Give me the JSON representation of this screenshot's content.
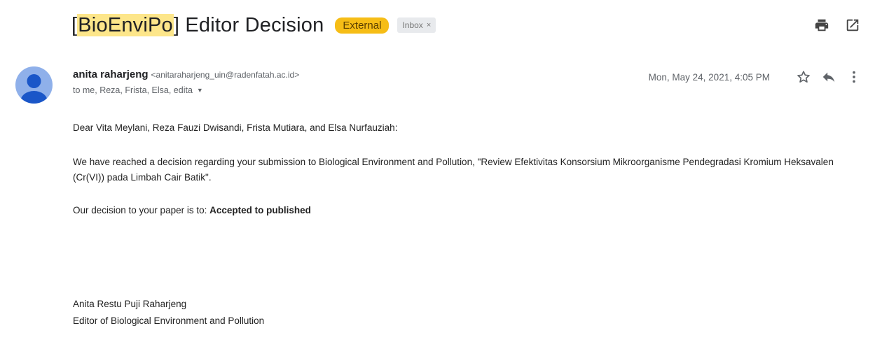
{
  "subject": {
    "tag": "BioEnviPo",
    "title": "Editor Decision"
  },
  "labels": {
    "external": "External",
    "inbox": "Inbox",
    "remove": "×"
  },
  "toolbar": {
    "print_icon": "print-icon",
    "open_new_window_icon": "open-in-new-icon"
  },
  "message": {
    "sender_name": "anita raharjeng",
    "sender_email": "<anitaraharjeng_uin@radenfatah.ac.id>",
    "recipients": "to me, Reza, Frista, Elsa, edita",
    "date": "Mon, May 24, 2021, 4:05 PM",
    "avatar_color": "#8fb0ea"
  },
  "body": {
    "greeting": "Dear Vita Meylani, Reza Fauzi Dwisandi, Frista Mutiara, and Elsa Nurfauziah:",
    "paragraph": "We have reached a decision regarding your submission to Biological Environment and Pollution, \"Review Efektivitas Konsorsium Mikroorganisme Pendegradasi Kromium Heksavalen (Cr(VI)) pada Limbah Cair Batik\".",
    "decision_prefix": "Our decision to your paper is to:",
    "decision_value": "Accepted to published"
  },
  "signature": {
    "name": "Anita Restu Puji Raharjeng",
    "role": "Editor of Biological Environment and Pollution"
  },
  "colors": {
    "external_badge": "#f6bd16",
    "subject_highlight": "#fde68a",
    "star_outline": "#5f6368"
  }
}
